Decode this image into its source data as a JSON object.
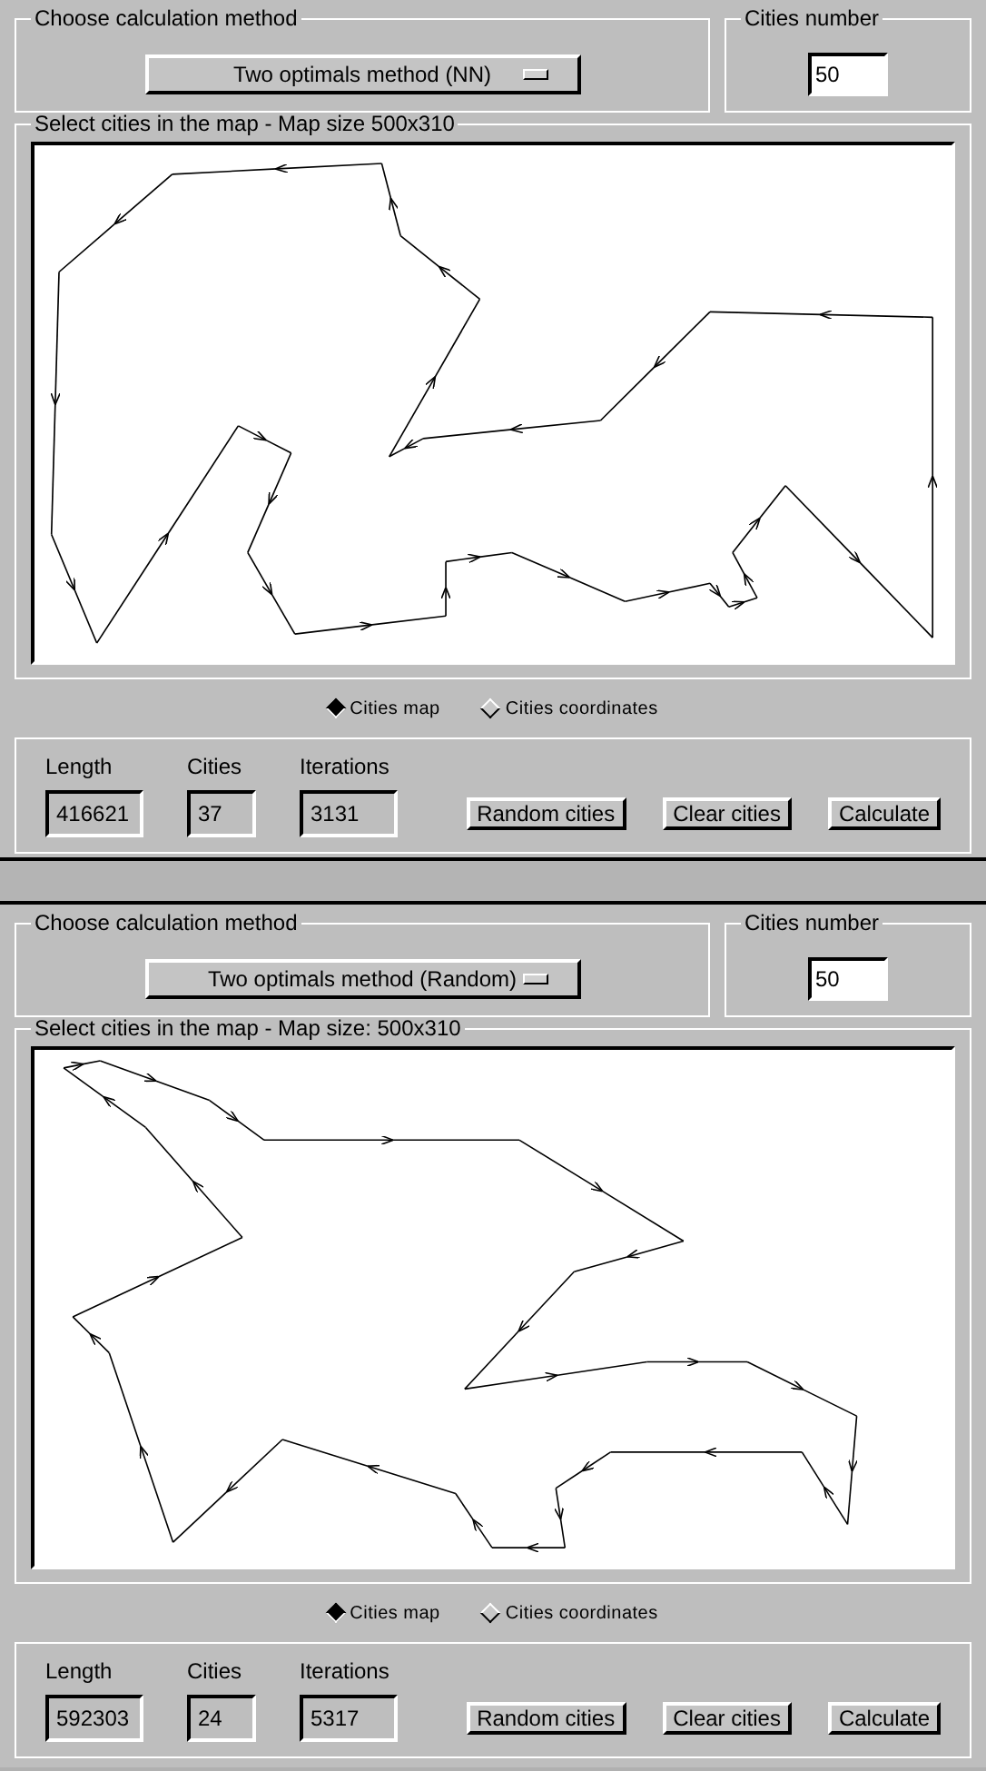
{
  "windows": [
    {
      "method_group": {
        "title": "Choose calculation method",
        "method": "Two optimals method (NN)"
      },
      "cities_group": {
        "title": "Cities number",
        "value": "50"
      },
      "map_group": {
        "title": "Select cities in the map - Map size  500x310"
      },
      "views": [
        {
          "label": "Cities map",
          "selected": true
        },
        {
          "label": "Cities coordinates",
          "selected": false
        }
      ],
      "results": [
        {
          "label": "Length",
          "value": "416621"
        },
        {
          "label": "Cities",
          "value": "37"
        },
        {
          "label": "Iterations",
          "value": "3131"
        }
      ],
      "buttons": [
        "Random cities",
        "Clear cities",
        "Calculate"
      ]
    },
    {
      "method_group": {
        "title": "Choose calculation method",
        "method": "Two optimals method (Random)"
      },
      "cities_group": {
        "title": "Cities number",
        "value": "50"
      },
      "map_group": {
        "title": "Select cities in the map - Map size: 500x310"
      },
      "views": [
        {
          "label": "Cities map",
          "selected": true
        },
        {
          "label": "Cities coordinates",
          "selected": false
        }
      ],
      "results": [
        {
          "label": "Length",
          "value": "592303"
        },
        {
          "label": "Cities",
          "value": "24"
        },
        {
          "label": "Iterations",
          "value": "5317"
        }
      ],
      "buttons": [
        "Random cities",
        "Clear cities",
        "Calculate"
      ]
    }
  ]
}
